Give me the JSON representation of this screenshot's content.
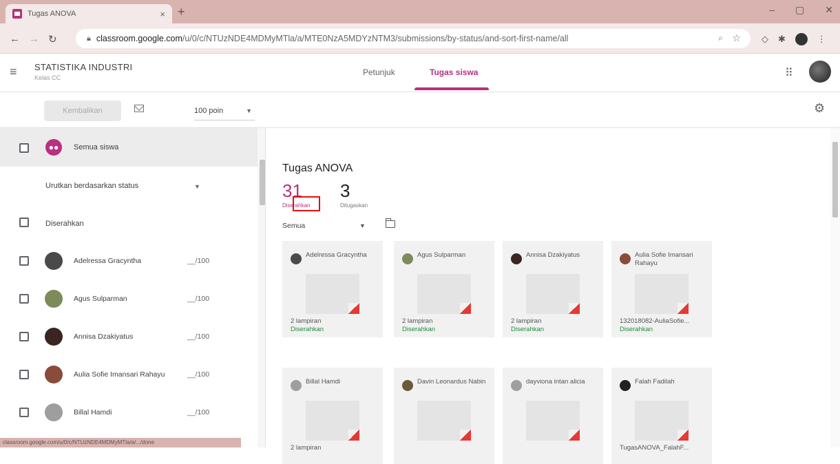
{
  "browser": {
    "tab_title": "Tugas ANOVA",
    "tab_close": "×",
    "new_tab": "+",
    "url_host": "classroom.google.com",
    "url_path": "/u/0/c/NTUzNDE4MDMyMTla/a/MTE0NzA5MDYzNTM3/submissions/by-status/and-sort-first-name/all",
    "status_url": "classroom.google.com/u/0/c/NTUzNDE4MDMyMTla/a/.../done"
  },
  "header": {
    "class_name": "STATISTIKA INDUSTRI",
    "class_section": "Kelas CC",
    "tabs": [
      {
        "label": "Petunjuk"
      },
      {
        "label": "Tugas siswa"
      }
    ]
  },
  "toolbar": {
    "return_label": "Kembalikan",
    "points_label": "100 poin"
  },
  "sidebar": {
    "all_students_label": "Semua siswa",
    "sort_label": "Urutkan berdasarkan status",
    "group_label": "Diserahkan",
    "students": [
      {
        "name": "Adelressa Gracyntha",
        "grade": "__/100",
        "color": "#4a4a4a"
      },
      {
        "name": "Agus Sulparman",
        "grade": "__/100",
        "color": "#7d8a5a"
      },
      {
        "name": "Annisa Dzakiyatus",
        "grade": "__/100",
        "color": "#3a2520"
      },
      {
        "name": "Aulia Sofie Imansari Rahayu",
        "grade": "__/100",
        "color": "#8a4b3a"
      },
      {
        "name": "Billal Hamdi",
        "grade": "__/100",
        "color": "#9e9e9e"
      }
    ]
  },
  "assignment": {
    "title": "Tugas ANOVA",
    "turned_in_count": "31",
    "turned_in_label": "Diserahkan",
    "assigned_count": "3",
    "assigned_label": "Ditugaskan",
    "filter_label": "Semua"
  },
  "cards": [
    {
      "name": "Adelressa Gracyntha",
      "attachments": "2 lampiran",
      "status": "Diserahkan",
      "color": "#4a4a4a"
    },
    {
      "name": "Agus Sulparman",
      "attachments": "2 lampiran",
      "status": "Diserahkan",
      "color": "#7d8a5a"
    },
    {
      "name": "Annisa Dzakiyatus",
      "attachments": "2 lampiran",
      "status": "Diserahkan",
      "color": "#3a2520"
    },
    {
      "name": "Aulia Sofie Imansari Rahayu",
      "attachments": "132018082-AuliaSofie...",
      "status": "Diserahkan",
      "color": "#8a4b3a"
    },
    {
      "name": "Billal Hamdi",
      "attachments": "2 lampiran",
      "status": "",
      "color": "#9e9e9e"
    },
    {
      "name": "Davin Leonardus Nabin",
      "attachments": "",
      "status": "",
      "color": "#6b5a3a"
    },
    {
      "name": "dayviona intan alicia",
      "attachments": "",
      "status": "",
      "color": "#9e9e9e"
    },
    {
      "name": "Falah Fadilah",
      "attachments": "TugasANOVA_FalahF...",
      "status": "",
      "color": "#222222"
    }
  ],
  "colors": {
    "accent": "#b8307f",
    "status_green": "#1e8e3e",
    "highlight": "#e01010"
  }
}
